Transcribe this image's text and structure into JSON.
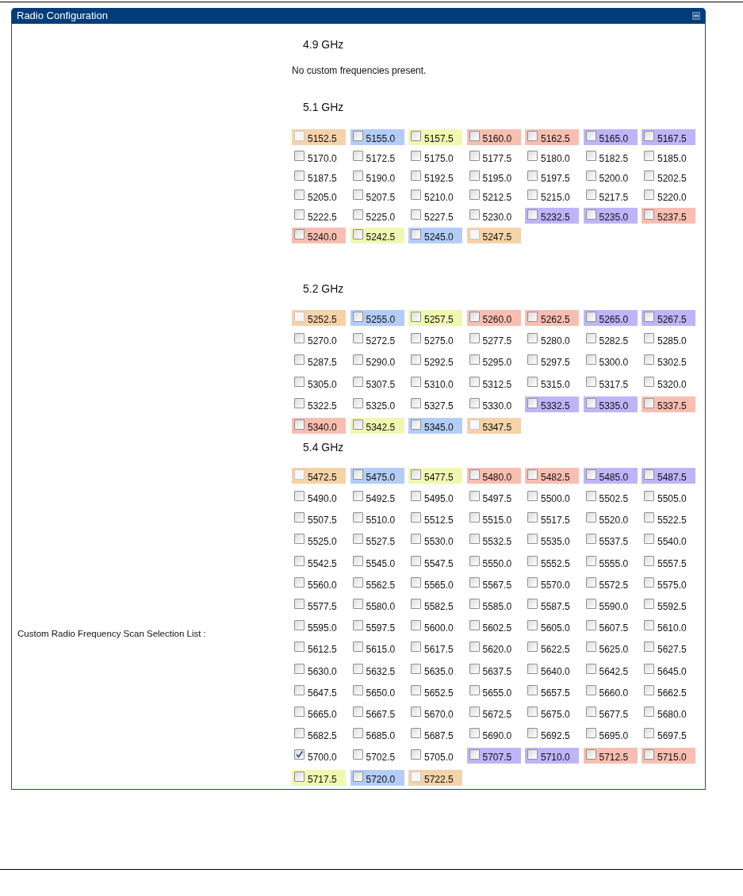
{
  "panel": {
    "title": "Radio Configuration",
    "field_label": "Custom Radio Frequency Scan Selection List :",
    "sections": [
      {
        "title": "4.9 GHz",
        "note": "No custom frequencies present."
      },
      {
        "title": "5.1 GHz",
        "frequencies": [
          {
            "label": "5152.5",
            "checked": false,
            "disabled": true,
            "color": "#f5d3a8"
          },
          {
            "label": "5155.0",
            "checked": false,
            "disabled": false,
            "color": "#b3cdf8"
          },
          {
            "label": "5157.5",
            "checked": false,
            "disabled": false,
            "color": "#f0f8b0"
          },
          {
            "label": "5160.0",
            "checked": false,
            "disabled": false,
            "color": "#f8beb2"
          },
          {
            "label": "5162.5",
            "checked": false,
            "disabled": false,
            "color": "#f8beb2"
          },
          {
            "label": "5165.0",
            "checked": false,
            "disabled": false,
            "color": "#c0b4f8"
          },
          {
            "label": "5167.5",
            "checked": false,
            "disabled": false,
            "color": "#c0b4f8"
          },
          {
            "label": "5170.0",
            "checked": false,
            "disabled": false
          },
          {
            "label": "5172.5",
            "checked": false,
            "disabled": false
          },
          {
            "label": "5175.0",
            "checked": false,
            "disabled": false
          },
          {
            "label": "5177.5",
            "checked": false,
            "disabled": false
          },
          {
            "label": "5180.0",
            "checked": false,
            "disabled": false
          },
          {
            "label": "5182.5",
            "checked": false,
            "disabled": false
          },
          {
            "label": "5185.0",
            "checked": false,
            "disabled": false
          },
          {
            "label": "5187.5",
            "checked": false,
            "disabled": false
          },
          {
            "label": "5190.0",
            "checked": false,
            "disabled": false
          },
          {
            "label": "5192.5",
            "checked": false,
            "disabled": false
          },
          {
            "label": "5195.0",
            "checked": false,
            "disabled": false
          },
          {
            "label": "5197.5",
            "checked": false,
            "disabled": false
          },
          {
            "label": "5200.0",
            "checked": false,
            "disabled": false
          },
          {
            "label": "5202.5",
            "checked": false,
            "disabled": false
          },
          {
            "label": "5205.0",
            "checked": false,
            "disabled": false
          },
          {
            "label": "5207.5",
            "checked": false,
            "disabled": false
          },
          {
            "label": "5210.0",
            "checked": false,
            "disabled": false
          },
          {
            "label": "5212.5",
            "checked": false,
            "disabled": false
          },
          {
            "label": "5215.0",
            "checked": false,
            "disabled": false
          },
          {
            "label": "5217.5",
            "checked": false,
            "disabled": false
          },
          {
            "label": "5220.0",
            "checked": false,
            "disabled": false
          },
          {
            "label": "5222.5",
            "checked": false,
            "disabled": false
          },
          {
            "label": "5225.0",
            "checked": false,
            "disabled": false
          },
          {
            "label": "5227.5",
            "checked": false,
            "disabled": false
          },
          {
            "label": "5230.0",
            "checked": false,
            "disabled": false
          },
          {
            "label": "5232.5",
            "checked": false,
            "disabled": false,
            "color": "#c0b4f8"
          },
          {
            "label": "5235.0",
            "checked": false,
            "disabled": false,
            "color": "#c0b4f8"
          },
          {
            "label": "5237.5",
            "checked": false,
            "disabled": false,
            "color": "#f8beb2"
          },
          {
            "label": "5240.0",
            "checked": false,
            "disabled": false,
            "color": "#f8beb2"
          },
          {
            "label": "5242.5",
            "checked": false,
            "disabled": false,
            "color": "#f0f8b0"
          },
          {
            "label": "5245.0",
            "checked": false,
            "disabled": false,
            "color": "#b3cdf8"
          },
          {
            "label": "5247.5",
            "checked": false,
            "disabled": true,
            "color": "#f5d3a8"
          }
        ]
      },
      {
        "title": "5.2 GHz",
        "frequencies": [
          {
            "label": "5252.5",
            "checked": false,
            "disabled": true,
            "color": "#f5d3a8"
          },
          {
            "label": "5255.0",
            "checked": false,
            "disabled": false,
            "color": "#b3cdf8"
          },
          {
            "label": "5257.5",
            "checked": false,
            "disabled": false,
            "color": "#f0f8b0"
          },
          {
            "label": "5260.0",
            "checked": false,
            "disabled": false,
            "color": "#f8beb2"
          },
          {
            "label": "5262.5",
            "checked": false,
            "disabled": false,
            "color": "#f8beb2"
          },
          {
            "label": "5265.0",
            "checked": false,
            "disabled": false,
            "color": "#c0b4f8"
          },
          {
            "label": "5267.5",
            "checked": false,
            "disabled": false,
            "color": "#c0b4f8"
          },
          {
            "label": "5270.0",
            "checked": false,
            "disabled": false
          },
          {
            "label": "5272.5",
            "checked": false,
            "disabled": false
          },
          {
            "label": "5275.0",
            "checked": false,
            "disabled": false
          },
          {
            "label": "5277.5",
            "checked": false,
            "disabled": false
          },
          {
            "label": "5280.0",
            "checked": false,
            "disabled": false
          },
          {
            "label": "5282.5",
            "checked": false,
            "disabled": false
          },
          {
            "label": "5285.0",
            "checked": false,
            "disabled": false
          },
          {
            "label": "5287.5",
            "checked": false,
            "disabled": false
          },
          {
            "label": "5290.0",
            "checked": false,
            "disabled": false
          },
          {
            "label": "5292.5",
            "checked": false,
            "disabled": false
          },
          {
            "label": "5295.0",
            "checked": false,
            "disabled": false
          },
          {
            "label": "5297.5",
            "checked": false,
            "disabled": false
          },
          {
            "label": "5300.0",
            "checked": false,
            "disabled": false
          },
          {
            "label": "5302.5",
            "checked": false,
            "disabled": false
          },
          {
            "label": "5305.0",
            "checked": false,
            "disabled": false
          },
          {
            "label": "5307.5",
            "checked": false,
            "disabled": false
          },
          {
            "label": "5310.0",
            "checked": false,
            "disabled": false
          },
          {
            "label": "5312.5",
            "checked": false,
            "disabled": false
          },
          {
            "label": "5315.0",
            "checked": false,
            "disabled": false
          },
          {
            "label": "5317.5",
            "checked": false,
            "disabled": false
          },
          {
            "label": "5320.0",
            "checked": false,
            "disabled": false
          },
          {
            "label": "5322.5",
            "checked": false,
            "disabled": false
          },
          {
            "label": "5325.0",
            "checked": false,
            "disabled": false
          },
          {
            "label": "5327.5",
            "checked": false,
            "disabled": false
          },
          {
            "label": "5330.0",
            "checked": false,
            "disabled": false
          },
          {
            "label": "5332.5",
            "checked": false,
            "disabled": false,
            "color": "#c0b4f8"
          },
          {
            "label": "5335.0",
            "checked": false,
            "disabled": false,
            "color": "#c0b4f8"
          },
          {
            "label": "5337.5",
            "checked": false,
            "disabled": false,
            "color": "#f8beb2"
          },
          {
            "label": "5340.0",
            "checked": false,
            "disabled": false,
            "color": "#f8beb2"
          },
          {
            "label": "5342.5",
            "checked": false,
            "disabled": false,
            "color": "#f0f8b0"
          },
          {
            "label": "5345.0",
            "checked": false,
            "disabled": false,
            "color": "#b3cdf8"
          },
          {
            "label": "5347.5",
            "checked": false,
            "disabled": true,
            "color": "#f5d3a8"
          }
        ]
      },
      {
        "title": "5.4 GHz",
        "frequencies": [
          {
            "label": "5472.5",
            "checked": false,
            "disabled": true,
            "color": "#f5d3a8"
          },
          {
            "label": "5475.0",
            "checked": false,
            "disabled": false,
            "color": "#b3cdf8"
          },
          {
            "label": "5477.5",
            "checked": false,
            "disabled": false,
            "color": "#f0f8b0"
          },
          {
            "label": "5480.0",
            "checked": false,
            "disabled": false,
            "color": "#f8beb2"
          },
          {
            "label": "5482.5",
            "checked": false,
            "disabled": false,
            "color": "#f8beb2"
          },
          {
            "label": "5485.0",
            "checked": false,
            "disabled": false,
            "color": "#c0b4f8"
          },
          {
            "label": "5487.5",
            "checked": false,
            "disabled": false,
            "color": "#c0b4f8"
          },
          {
            "label": "5490.0",
            "checked": false,
            "disabled": false
          },
          {
            "label": "5492.5",
            "checked": false,
            "disabled": false
          },
          {
            "label": "5495.0",
            "checked": false,
            "disabled": false
          },
          {
            "label": "5497.5",
            "checked": false,
            "disabled": false
          },
          {
            "label": "5500.0",
            "checked": false,
            "disabled": false
          },
          {
            "label": "5502.5",
            "checked": false,
            "disabled": false
          },
          {
            "label": "5505.0",
            "checked": false,
            "disabled": false
          },
          {
            "label": "5507.5",
            "checked": false,
            "disabled": false
          },
          {
            "label": "5510.0",
            "checked": false,
            "disabled": false
          },
          {
            "label": "5512.5",
            "checked": false,
            "disabled": false
          },
          {
            "label": "5515.0",
            "checked": false,
            "disabled": false
          },
          {
            "label": "5517.5",
            "checked": false,
            "disabled": false
          },
          {
            "label": "5520.0",
            "checked": false,
            "disabled": false
          },
          {
            "label": "5522.5",
            "checked": false,
            "disabled": false
          },
          {
            "label": "5525.0",
            "checked": false,
            "disabled": false
          },
          {
            "label": "5527.5",
            "checked": false,
            "disabled": false
          },
          {
            "label": "5530.0",
            "checked": false,
            "disabled": false
          },
          {
            "label": "5532.5",
            "checked": false,
            "disabled": false
          },
          {
            "label": "5535.0",
            "checked": false,
            "disabled": false
          },
          {
            "label": "5537.5",
            "checked": false,
            "disabled": false
          },
          {
            "label": "5540.0",
            "checked": false,
            "disabled": false
          },
          {
            "label": "5542.5",
            "checked": false,
            "disabled": false
          },
          {
            "label": "5545.0",
            "checked": false,
            "disabled": false
          },
          {
            "label": "5547.5",
            "checked": false,
            "disabled": false
          },
          {
            "label": "5550.0",
            "checked": false,
            "disabled": false
          },
          {
            "label": "5552.5",
            "checked": false,
            "disabled": false
          },
          {
            "label": "5555.0",
            "checked": false,
            "disabled": false
          },
          {
            "label": "5557.5",
            "checked": false,
            "disabled": false
          },
          {
            "label": "5560.0",
            "checked": false,
            "disabled": false
          },
          {
            "label": "5562.5",
            "checked": false,
            "disabled": false
          },
          {
            "label": "5565.0",
            "checked": false,
            "disabled": false
          },
          {
            "label": "5567.5",
            "checked": false,
            "disabled": false
          },
          {
            "label": "5570.0",
            "checked": false,
            "disabled": false
          },
          {
            "label": "5572.5",
            "checked": false,
            "disabled": false
          },
          {
            "label": "5575.0",
            "checked": false,
            "disabled": false
          },
          {
            "label": "5577.5",
            "checked": false,
            "disabled": false
          },
          {
            "label": "5580.0",
            "checked": false,
            "disabled": false
          },
          {
            "label": "5582.5",
            "checked": false,
            "disabled": false
          },
          {
            "label": "5585.0",
            "checked": false,
            "disabled": false
          },
          {
            "label": "5587.5",
            "checked": false,
            "disabled": false
          },
          {
            "label": "5590.0",
            "checked": false,
            "disabled": false
          },
          {
            "label": "5592.5",
            "checked": false,
            "disabled": false
          },
          {
            "label": "5595.0",
            "checked": false,
            "disabled": false
          },
          {
            "label": "5597.5",
            "checked": false,
            "disabled": false
          },
          {
            "label": "5600.0",
            "checked": false,
            "disabled": false
          },
          {
            "label": "5602.5",
            "checked": false,
            "disabled": false
          },
          {
            "label": "5605.0",
            "checked": false,
            "disabled": false
          },
          {
            "label": "5607.5",
            "checked": false,
            "disabled": false
          },
          {
            "label": "5610.0",
            "checked": false,
            "disabled": false
          },
          {
            "label": "5612.5",
            "checked": false,
            "disabled": false
          },
          {
            "label": "5615.0",
            "checked": false,
            "disabled": false
          },
          {
            "label": "5617.5",
            "checked": false,
            "disabled": false
          },
          {
            "label": "5620.0",
            "checked": false,
            "disabled": false
          },
          {
            "label": "5622.5",
            "checked": false,
            "disabled": false
          },
          {
            "label": "5625.0",
            "checked": false,
            "disabled": false
          },
          {
            "label": "5627.5",
            "checked": false,
            "disabled": false
          },
          {
            "label": "5630.0",
            "checked": false,
            "disabled": false
          },
          {
            "label": "5632.5",
            "checked": false,
            "disabled": false
          },
          {
            "label": "5635.0",
            "checked": false,
            "disabled": false
          },
          {
            "label": "5637.5",
            "checked": false,
            "disabled": false
          },
          {
            "label": "5640.0",
            "checked": false,
            "disabled": false
          },
          {
            "label": "5642.5",
            "checked": false,
            "disabled": false
          },
          {
            "label": "5645.0",
            "checked": false,
            "disabled": false
          },
          {
            "label": "5647.5",
            "checked": false,
            "disabled": false
          },
          {
            "label": "5650.0",
            "checked": false,
            "disabled": false
          },
          {
            "label": "5652.5",
            "checked": false,
            "disabled": false
          },
          {
            "label": "5655.0",
            "checked": false,
            "disabled": false
          },
          {
            "label": "5657.5",
            "checked": false,
            "disabled": false
          },
          {
            "label": "5660.0",
            "checked": false,
            "disabled": false
          },
          {
            "label": "5662.5",
            "checked": false,
            "disabled": false
          },
          {
            "label": "5665.0",
            "checked": false,
            "disabled": false
          },
          {
            "label": "5667.5",
            "checked": false,
            "disabled": false
          },
          {
            "label": "5670.0",
            "checked": false,
            "disabled": false
          },
          {
            "label": "5672.5",
            "checked": false,
            "disabled": false
          },
          {
            "label": "5675.0",
            "checked": false,
            "disabled": false
          },
          {
            "label": "5677.5",
            "checked": false,
            "disabled": false
          },
          {
            "label": "5680.0",
            "checked": false,
            "disabled": false
          },
          {
            "label": "5682.5",
            "checked": false,
            "disabled": false
          },
          {
            "label": "5685.0",
            "checked": false,
            "disabled": false
          },
          {
            "label": "5687.5",
            "checked": false,
            "disabled": false
          },
          {
            "label": "5690.0",
            "checked": false,
            "disabled": false
          },
          {
            "label": "5692.5",
            "checked": false,
            "disabled": false
          },
          {
            "label": "5695.0",
            "checked": false,
            "disabled": false
          },
          {
            "label": "5697.5",
            "checked": false,
            "disabled": false
          },
          {
            "label": "5700.0",
            "checked": true,
            "disabled": false
          },
          {
            "label": "5702.5",
            "checked": false,
            "disabled": false
          },
          {
            "label": "5705.0",
            "checked": false,
            "disabled": false
          },
          {
            "label": "5707.5",
            "checked": false,
            "disabled": false,
            "color": "#c0b4f8"
          },
          {
            "label": "5710.0",
            "checked": false,
            "disabled": false,
            "color": "#c0b4f8"
          },
          {
            "label": "5712.5",
            "checked": false,
            "disabled": false,
            "color": "#f8beb2"
          },
          {
            "label": "5715.0",
            "checked": false,
            "disabled": false,
            "color": "#f8beb2"
          },
          {
            "label": "5717.5",
            "checked": false,
            "disabled": false,
            "color": "#f0f8b0"
          },
          {
            "label": "5720.0",
            "checked": false,
            "disabled": false,
            "color": "#b3cdf8"
          },
          {
            "label": "5722.5",
            "checked": false,
            "disabled": true,
            "color": "#f5d3a8"
          }
        ]
      }
    ]
  }
}
